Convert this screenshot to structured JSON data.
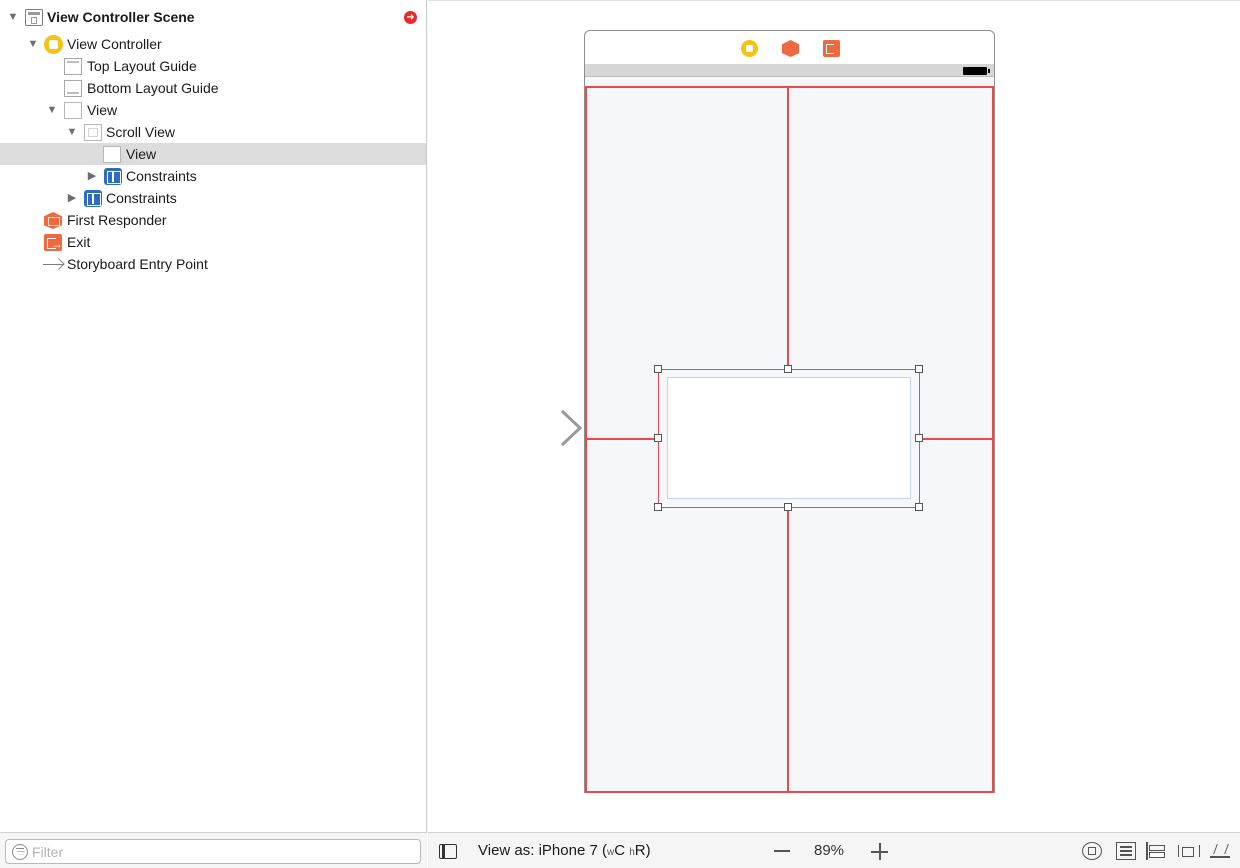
{
  "outline": {
    "scene": {
      "label": "View Controller Scene"
    },
    "items": [
      {
        "label": "View Controller"
      },
      {
        "label": "Top Layout Guide"
      },
      {
        "label": "Bottom Layout Guide"
      },
      {
        "label": "View"
      },
      {
        "label": "Scroll View"
      },
      {
        "label": "View"
      },
      {
        "label": "Constraints"
      },
      {
        "label": "Constraints"
      },
      {
        "label": "First Responder"
      },
      {
        "label": "Exit"
      },
      {
        "label": "Storyboard Entry Point"
      }
    ],
    "selected_item": "View (inside Scroll View)",
    "warning_glyph": "➜"
  },
  "filter": {
    "placeholder": "Filter",
    "value": ""
  },
  "toolbar": {
    "view_as_prefix": "View as: iPhone 7 (",
    "width_class_prefix": "w",
    "width_class": "C",
    "height_class_prefix": "h",
    "height_class": "R",
    "view_as_suffix": ")",
    "zoom_level": "89%"
  },
  "colors": {
    "constraint_red": "#ec4a4a",
    "selection_grey": "#dcdcdc",
    "controller_yellow": "#f7c117",
    "responder_orange": "#f0683d",
    "constraints_blue": "#2f6ac3",
    "canvas_background": "#f5f7fb"
  },
  "icons": [
    "scene-icon",
    "view-controller-icon",
    "layout-guide-icon",
    "view-icon",
    "scroll-view-icon",
    "constraints-icon",
    "first-responder-icon",
    "exit-icon",
    "entry-point-arrow-icon",
    "filter-icon",
    "outline-toggle-icon",
    "zoom-out-icon",
    "zoom-in-icon",
    "update-frames-icon",
    "embed-in-stack-icon",
    "align-icon",
    "pin-icon",
    "resolve-issues-icon",
    "battery-icon",
    "warning-icon"
  ]
}
